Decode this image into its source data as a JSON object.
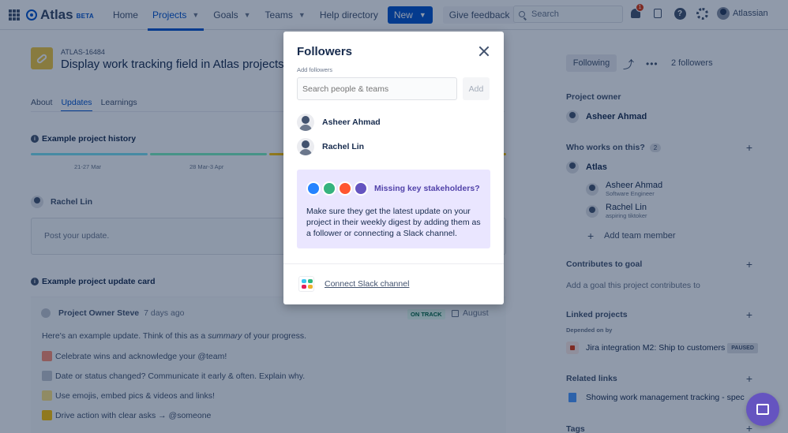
{
  "nav": {
    "brand": "Atlas",
    "beta": "BETA",
    "items": [
      {
        "label": "Home",
        "chevron": false
      },
      {
        "label": "Projects",
        "chevron": true,
        "active": true
      },
      {
        "label": "Goals",
        "chevron": true
      },
      {
        "label": "Teams",
        "chevron": true
      },
      {
        "label": "Help directory",
        "chevron": false
      }
    ],
    "new_label": "New",
    "feedback_label": "Give feedback",
    "search_placeholder": "Search",
    "notification_count": "1",
    "user_label": "Atlassian"
  },
  "project": {
    "key": "ATLAS-16484",
    "title": "Display work tracking field in Atlas projects",
    "tabs": [
      "About",
      "Updates",
      "Learnings"
    ],
    "active_tab": "Updates"
  },
  "history": {
    "heading": "Example project history",
    "labels": [
      "21-27 Mar",
      "28 Mar-3 Apr"
    ],
    "colors": [
      "#79e2f2",
      "#79f2c0",
      "#ffc400"
    ]
  },
  "composer": {
    "author": "Rachel Lin",
    "placeholder": "Post your update."
  },
  "update_card": {
    "heading": "Example project update card",
    "author": "Project Owner Steve",
    "time": "7 days ago",
    "status": "ON TRACK",
    "month": "August",
    "intro_before": "Here's an example update. Think of this as a ",
    "intro_em": "summary",
    "intro_after": " of your progress.",
    "lines": [
      "Celebrate wins and acknowledge your @team!",
      "Date or status changed? Communicate it early & often. Explain why.",
      "Use emojis, embed pics & videos and links!",
      "Drive action with clear asks → @someone"
    ]
  },
  "side": {
    "following_label": "Following",
    "followers_count": "2 followers",
    "owner_heading": "Project owner",
    "owner_name": "Asheer Ahmad",
    "works_heading": "Who works on this?",
    "works_count": "2",
    "team_name": "Atlas",
    "members": [
      {
        "name": "Asheer Ahmad",
        "role": "Software Engineer"
      },
      {
        "name": "Rachel Lin",
        "role": "aspiring tiktoker"
      }
    ],
    "add_member": "Add team member",
    "goal_heading": "Contributes to goal",
    "goal_hint": "Add a goal this project contributes to",
    "linked_heading": "Linked projects",
    "depended_label": "Depended on by",
    "linked_project": "Jira integration M2: Ship to customers",
    "linked_status": "PAUSED",
    "related_heading": "Related links",
    "related_link": "Showing work management tracking - spec",
    "tags_heading": "Tags"
  },
  "modal": {
    "title": "Followers",
    "add_label": "Add followers",
    "input_placeholder": "Search people & teams",
    "add_button": "Add",
    "followers": [
      "Asheer Ahmad",
      "Rachel Lin"
    ],
    "stakeholders_title": "Missing key stakeholders?",
    "stakeholders_text": "Make sure they get the latest update on your project in their weekly digest by adding them as a follower or connecting a Slack channel.",
    "slack_label": "Connect Slack channel"
  }
}
